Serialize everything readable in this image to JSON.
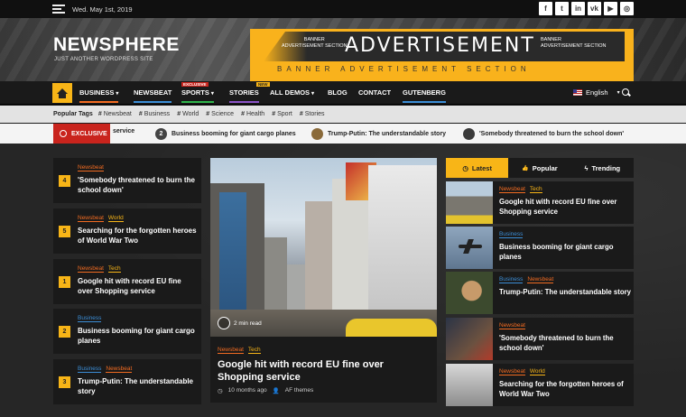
{
  "topbar": {
    "date": "Wed. May 1st, 2019",
    "socials": [
      {
        "icon": "facebook-icon",
        "glyph": "f"
      },
      {
        "icon": "twitter-icon",
        "glyph": "t"
      },
      {
        "icon": "linkedin-icon",
        "glyph": "in"
      },
      {
        "icon": "vk-icon",
        "glyph": "vk"
      },
      {
        "icon": "youtube-icon",
        "glyph": "▶"
      },
      {
        "icon": "instagram-icon",
        "glyph": "◎"
      }
    ]
  },
  "header": {
    "logo": "NEWSPHERE",
    "tagline": "JUST ANOTHER WORDPRESS SITE",
    "ad": {
      "big": "ADVERTISEMENT",
      "small_left": "BANNER\nADVERTISEMENT SECTION",
      "small_right": "BANNER\nADVERTISEMENT SECTION",
      "bottom": "BANNER ADVERTISEMENT SECTION"
    }
  },
  "nav": {
    "items": [
      {
        "label": "BUSINESS",
        "chev": "▾"
      },
      {
        "label": "NEWSBEAT"
      },
      {
        "label": "SPORTS",
        "chev": "▾",
        "flag": "EXCLUSIVE"
      },
      {
        "label": "STORIES",
        "flag": "NEW"
      },
      {
        "label": "ALL DEMOS",
        "chev": "▾"
      },
      {
        "label": "BLOG"
      },
      {
        "label": "CONTACT"
      },
      {
        "label": "GUTENBERG"
      }
    ],
    "language": "English",
    "lang_chev": "▾"
  },
  "tags": {
    "title": "Popular Tags",
    "items": [
      "Newsbeat",
      "Business",
      "World",
      "Science",
      "Health",
      "Sport",
      "Stories"
    ]
  },
  "ticker": {
    "label": "EXCLUSIVE",
    "lead": "service",
    "items": [
      {
        "num": "2",
        "text": "Business booming for giant cargo planes"
      },
      {
        "text": "Trump-Putin: The understandable story"
      },
      {
        "text": "'Somebody threatened to burn the school down'"
      }
    ]
  },
  "left_list": [
    {
      "num": "4",
      "cats": [
        "Newsbeat"
      ],
      "title": "'Somebody threatened to burn the school down'"
    },
    {
      "num": "5",
      "cats": [
        "Newsbeat",
        "World"
      ],
      "title": "Searching for the forgotten heroes of World War Two"
    },
    {
      "num": "1",
      "cats": [
        "Newsbeat",
        "Tech"
      ],
      "title": "Google hit with record EU fine over Shopping service"
    },
    {
      "num": "2",
      "cats": [
        "Business"
      ],
      "title": "Business booming for giant cargo planes"
    },
    {
      "num": "3",
      "cats": [
        "Business",
        "Newsbeat"
      ],
      "title": "Trump-Putin: The understandable story"
    }
  ],
  "hero": {
    "read_time": "2 min read",
    "cats": [
      "Newsbeat",
      "Tech"
    ],
    "title": "Google hit with record EU fine over Shopping service",
    "time": "10 months ago",
    "author": "AF themes"
  },
  "tabs": [
    {
      "label": "Latest",
      "icon": "clock-icon",
      "glyph": "◷"
    },
    {
      "label": "Popular",
      "icon": "thumbs-up-icon",
      "glyph": "👍"
    },
    {
      "label": "Trending",
      "icon": "flash-icon",
      "glyph": "ϟ"
    }
  ],
  "right_list": [
    {
      "cats": [
        "Newsbeat",
        "Tech"
      ],
      "title": "Google hit with record EU fine over Shopping service"
    },
    {
      "cats": [
        "Business"
      ],
      "title": "Business booming for giant cargo planes"
    },
    {
      "cats": [
        "Business",
        "Newsbeat"
      ],
      "title": "Trump-Putin: The understandable story"
    },
    {
      "cats": [
        "Newsbeat"
      ],
      "title": "'Somebody threatened to burn the school down'"
    },
    {
      "cats": [
        "Newsbeat",
        "World"
      ],
      "title": "Searching for the forgotten heroes of World War Two"
    }
  ],
  "colors": {
    "accent": "#f8b517",
    "exclusive_red": "#c9241d",
    "newsbeat": "#f26b21",
    "business": "#3b8dd6"
  }
}
